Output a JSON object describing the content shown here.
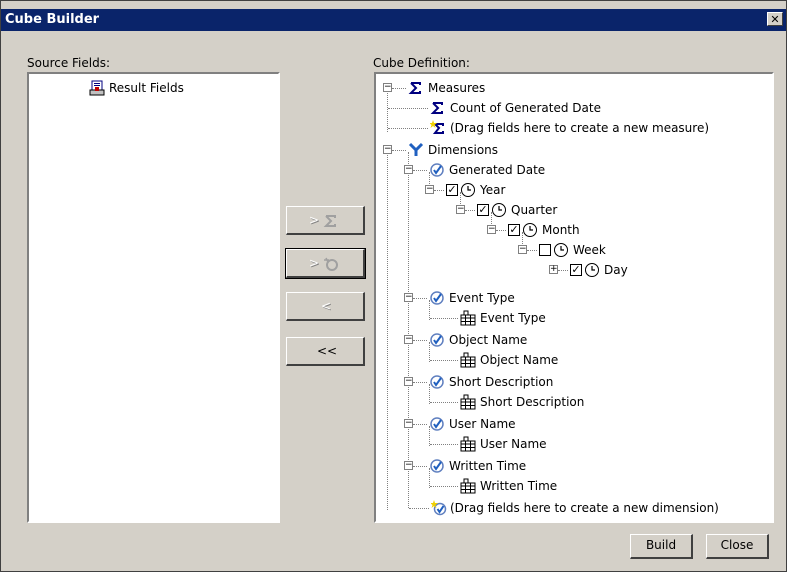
{
  "window": {
    "title": "Cube Builder",
    "close_glyph": "✕"
  },
  "source": {
    "label": "Source Fields:",
    "item": "Result Fields"
  },
  "cube": {
    "label": "Cube Definition:"
  },
  "middle_buttons": {
    "add_measure": ">",
    "add_dimension": ">",
    "remove": "<",
    "remove_all": "<<"
  },
  "tree": {
    "measures": "Measures",
    "count_measure": "Count of Generated Date",
    "drag_measure": "(Drag fields here to create a new measure)",
    "dimensions": "Dimensions",
    "generated_date": "Generated Date",
    "year": "Year",
    "quarter": "Quarter",
    "month": "Month",
    "week": "Week",
    "day": "Day",
    "event_type_dim": "Event Type",
    "event_type_lvl": "Event Type",
    "object_name_dim": "Object Name",
    "object_name_lvl": "Object Name",
    "short_desc_dim": "Short Description",
    "short_desc_lvl": "Short Description",
    "user_name_dim": "User Name",
    "user_name_lvl": "User Name",
    "written_time_dim": "Written Time",
    "written_time_lvl": "Written Time",
    "drag_dimension": "(Drag fields here to create a new dimension)"
  },
  "checks": {
    "year": true,
    "quarter": true,
    "month": true,
    "week": false,
    "day": true
  },
  "footer": {
    "build": "Build",
    "close": "Close"
  }
}
